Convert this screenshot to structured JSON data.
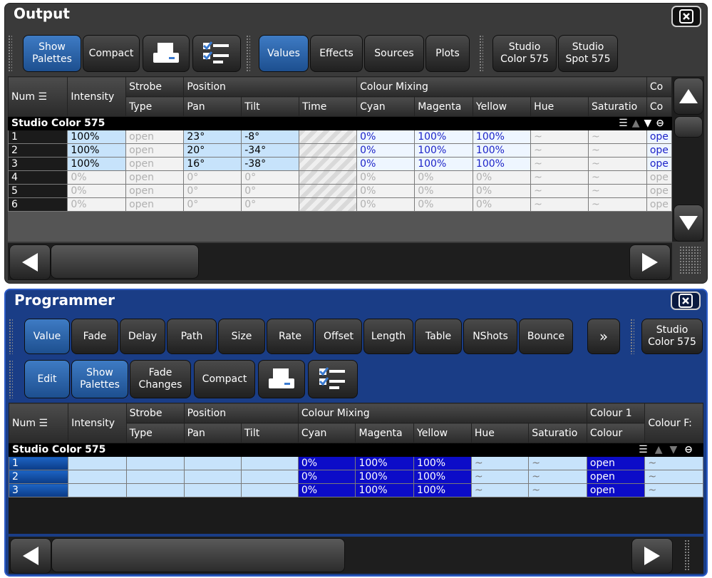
{
  "output": {
    "title": "Output",
    "close_icon": "close-icon",
    "toolbar": {
      "show_palettes": "Show\nPalettes",
      "compact": "Compact",
      "print_icon": "print-icon",
      "checklist_icon": "checklist-icon",
      "values": "Values",
      "effects": "Effects",
      "sources": "Sources",
      "plots": "Plots",
      "studio_color": "Studio\nColor 575",
      "studio_spot": "Studio\nSpot 575"
    },
    "headers_top": {
      "num": "Num",
      "intensity": "Intensity",
      "strobe": "Strobe",
      "position": "Position",
      "colour_mixing": "Colour Mixing",
      "co": "Co"
    },
    "headers_bottom": {
      "type": "Type",
      "pan": "Pan",
      "tilt": "Tilt",
      "time": "Time",
      "cyan": "Cyan",
      "magenta": "Magenta",
      "yellow": "Yellow",
      "hue": "Hue",
      "saturation": "Saturatio",
      "co": "Co"
    },
    "fixture_label": "Studio Color 575",
    "group_icons": {
      "sort": "sort-icon",
      "up": "triangle-up-icon",
      "down": "triangle-down-icon",
      "collapse": "minus-circle-icon"
    },
    "rows": [
      {
        "num": "1",
        "intensity": "100%",
        "type": "open",
        "pan": "23°",
        "tilt": "-8°",
        "cyan": "0%",
        "magenta": "100%",
        "yellow": "100%",
        "hue": "~",
        "sat": "~",
        "co": "ope",
        "active": true
      },
      {
        "num": "2",
        "intensity": "100%",
        "type": "open",
        "pan": "20°",
        "tilt": "-34°",
        "cyan": "0%",
        "magenta": "100%",
        "yellow": "100%",
        "hue": "~",
        "sat": "~",
        "co": "ope",
        "active": true
      },
      {
        "num": "3",
        "intensity": "100%",
        "type": "open",
        "pan": "16°",
        "tilt": "-38°",
        "cyan": "0%",
        "magenta": "100%",
        "yellow": "100%",
        "hue": "~",
        "sat": "~",
        "co": "ope",
        "active": true
      },
      {
        "num": "4",
        "intensity": "0%",
        "type": "open",
        "pan": "0°",
        "tilt": "0°",
        "cyan": "0%",
        "magenta": "0%",
        "yellow": "0%",
        "hue": "~",
        "sat": "~",
        "co": "ope",
        "active": false
      },
      {
        "num": "5",
        "intensity": "0%",
        "type": "open",
        "pan": "0°",
        "tilt": "0°",
        "cyan": "0%",
        "magenta": "0%",
        "yellow": "0%",
        "hue": "~",
        "sat": "~",
        "co": "ope",
        "active": false
      },
      {
        "num": "6",
        "intensity": "0%",
        "type": "open",
        "pan": "0°",
        "tilt": "0°",
        "cyan": "0%",
        "magenta": "0%",
        "yellow": "0%",
        "hue": "~",
        "sat": "~",
        "co": "ope",
        "active": false
      }
    ]
  },
  "programmer": {
    "title": "Programmer",
    "close_icon": "close-icon",
    "toolbar1": {
      "value": "Value",
      "fade": "Fade",
      "delay": "Delay",
      "path": "Path",
      "size": "Size",
      "rate": "Rate",
      "offset": "Offset",
      "length": "Length",
      "table": "Table",
      "nshots": "NShots",
      "bounce": "Bounce",
      "more": "»",
      "studio_color": "Studio\nColor 575"
    },
    "toolbar2": {
      "edit": "Edit",
      "show_palettes": "Show\nPalettes",
      "fade_changes": "Fade\nChanges",
      "compact": "Compact",
      "print_icon": "print-icon",
      "checklist_icon": "checklist-icon"
    },
    "headers_top": {
      "num": "Num",
      "intensity": "Intensity",
      "strobe": "Strobe",
      "position": "Position",
      "colour_mixing": "Colour Mixing",
      "colour1": "Colour 1",
      "colour_fx": "Colour F:"
    },
    "headers_bottom": {
      "type": "Type",
      "pan": "Pan",
      "tilt": "Tilt",
      "cyan": "Cyan",
      "magenta": "Magenta",
      "yellow": "Yellow",
      "hue": "Hue",
      "saturation": "Saturatio",
      "colour": "Colour"
    },
    "fixture_label": "Studio Color 575",
    "rows": [
      {
        "num": "1",
        "cyan": "0%",
        "magenta": "100%",
        "yellow": "100%",
        "hue": "~",
        "sat": "~",
        "colour": "open",
        "fx": "~"
      },
      {
        "num": "2",
        "cyan": "0%",
        "magenta": "100%",
        "yellow": "100%",
        "hue": "~",
        "sat": "~",
        "colour": "open",
        "fx": "~"
      },
      {
        "num": "3",
        "cyan": "0%",
        "magenta": "100%",
        "yellow": "100%",
        "hue": "~",
        "sat": "~",
        "colour": "open",
        "fx": "~"
      }
    ]
  }
}
